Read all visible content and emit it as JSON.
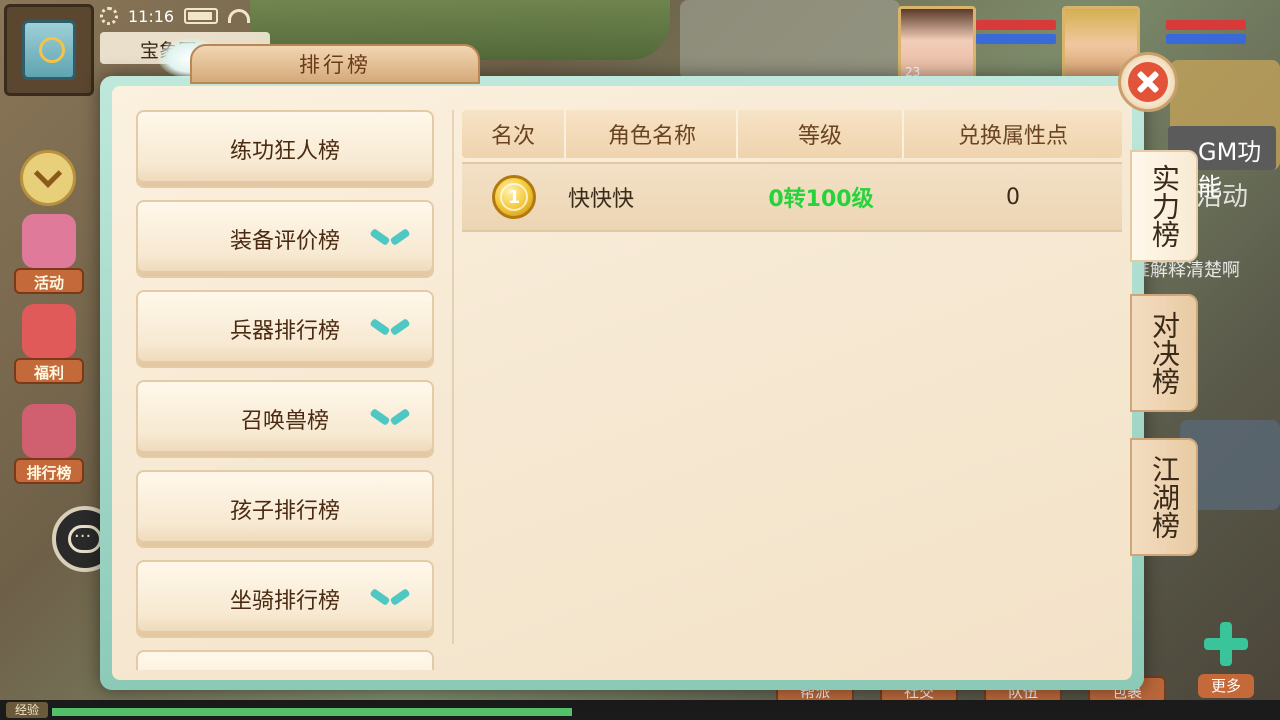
{
  "status": {
    "time": "11:16"
  },
  "location": {
    "name": "宝象国"
  },
  "side_buttons": [
    {
      "label": "活动",
      "color": "#e07a9a"
    },
    {
      "label": "福利",
      "color": "#e05a5a"
    },
    {
      "label": "排行榜",
      "color": "#d06070"
    }
  ],
  "top_right": {
    "player_level": "23",
    "gm_label": "GM功能",
    "activity_label": "活动",
    "hint_text": "谁解释清楚啊"
  },
  "bottom_buttons": [
    "帮派",
    "社交",
    "队伍",
    "包裹"
  ],
  "more_label": "更多",
  "exp_label": "经验",
  "modal": {
    "title": "排行榜",
    "categories": [
      {
        "label": "练功狂人榜",
        "expandable": false
      },
      {
        "label": "装备评价榜",
        "expandable": true
      },
      {
        "label": "兵器排行榜",
        "expandable": true
      },
      {
        "label": "召唤兽榜",
        "expandable": true
      },
      {
        "label": "孩子排行榜",
        "expandable": false
      },
      {
        "label": "坐骑排行榜",
        "expandable": true
      }
    ],
    "table": {
      "headers": [
        "名次",
        "角色名称",
        "等级",
        "兑换属性点"
      ],
      "rows": [
        {
          "rank": "1",
          "name": "快快快",
          "level": "0转100级",
          "points": "0"
        }
      ]
    },
    "right_tabs": [
      {
        "label": "实力榜",
        "active": true
      },
      {
        "label": "对决榜",
        "active": false
      },
      {
        "label": "江湖榜",
        "active": false
      }
    ]
  }
}
